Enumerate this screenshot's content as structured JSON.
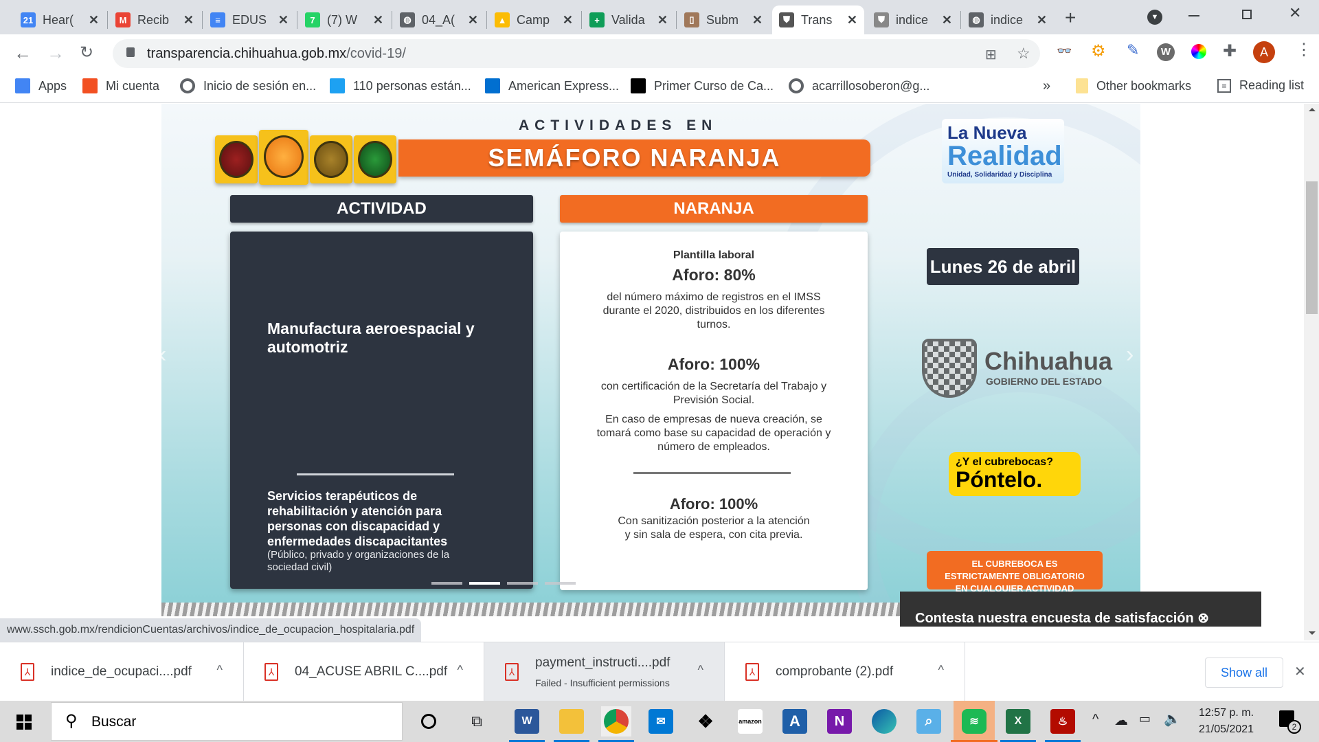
{
  "browser": {
    "tabs": [
      {
        "title": "Hear(",
        "icon": "google-calendar-icon",
        "color": "#4285f4",
        "glyph": "21"
      },
      {
        "title": "Recib",
        "icon": "gmail-icon",
        "color": "#ea4335",
        "glyph": "M"
      },
      {
        "title": "EDUS",
        "icon": "google-docs-icon",
        "color": "#4285f4",
        "glyph": "≡"
      },
      {
        "title": "(7) W",
        "icon": "whatsapp-icon",
        "color": "#25d366",
        "glyph": "7"
      },
      {
        "title": "04_A(",
        "icon": "globe-icon",
        "color": "#5f6368",
        "glyph": "◍"
      },
      {
        "title": "Camp",
        "icon": "google-drive-icon",
        "color": "#fbbc04",
        "glyph": "▲"
      },
      {
        "title": "Valida",
        "icon": "plus-cross-icon",
        "color": "#0f9d58",
        "glyph": "+"
      },
      {
        "title": "Subm",
        "icon": "door-icon",
        "color": "#a0785a",
        "glyph": "▯"
      },
      {
        "title": "Trans",
        "icon": "chihuahua-shield-icon",
        "color": "#555",
        "glyph": "⛊",
        "active": true
      },
      {
        "title": "indice",
        "icon": "chihuahua-shield-icon",
        "color": "#888",
        "glyph": "⛊"
      },
      {
        "title": "indice",
        "icon": "globe-icon",
        "color": "#5f6368",
        "glyph": "◍"
      }
    ],
    "new_tab": "+",
    "url_host": "transparencia.chihuahua.gob.mx",
    "url_path": "/covid-19/",
    "profile_initial": "A",
    "bookmarks": [
      {
        "label": "Apps",
        "icon": "apps-grid-icon"
      },
      {
        "label": "Mi cuenta",
        "icon": "microsoft-icon"
      },
      {
        "label": "Inicio de sesión en...",
        "icon": "globe-icon"
      },
      {
        "label": "110 personas están...",
        "icon": "twitter-icon"
      },
      {
        "label": "American Express...",
        "icon": "amex-icon"
      },
      {
        "label": "Primer Curso de Ca...",
        "icon": "x-icon"
      },
      {
        "label": "acarrillosoberon@g...",
        "icon": "globe-icon"
      }
    ],
    "bookmarks_overflow": "»",
    "other_bookmarks": "Other bookmarks",
    "reading_list": "Reading list"
  },
  "banner": {
    "heading_small": "ACTIVIDADES EN",
    "heading_big": "SEMÁFORO NARANJA",
    "col_activity_header": "ACTIVIDAD",
    "col_level_header": "NARANJA",
    "activity_1": "Manufactura aeroespacial y automotriz",
    "activity_2_title": "Servicios terapéuticos de rehabilitación y atención para personas con discapacidad y enfermedades discapacitantes",
    "activity_2_note": "(Público, privado y organizaciones de la sociedad civil)",
    "level_1_label": "Plantilla laboral",
    "level_1_aforo": "Aforo: 80%",
    "level_1_desc": "del número máximo de registros en el IMSS durante el 2020, distribuidos en los diferentes turnos.",
    "level_1b_aforo": "Aforo: 100%",
    "level_1b_desc": "con certificación de la Secretaría del Trabajo y Previsión Social.",
    "level_1b_note": "En caso de empresas de nueva creación, se tomará como base su capacidad de operación y número de empleados.",
    "level_2_aforo": "Aforo: 100%",
    "level_2_desc": "Con sanitización posterior a la atención y sin sala de espera, con cita previa.",
    "brand_line1": "La Nueva",
    "brand_line2": "Realidad",
    "brand_tagline": "Unidad, Solidaridad y Disciplina",
    "date": "Lunes 26 de abril",
    "gov_name": "Chihuahua",
    "gov_sub": "GOBIERNO DEL ESTADO",
    "mask_q": "¿Y el cubrebocas?",
    "mask_cta": "Póntelo.",
    "mask_notice": "EL CUBREBOCA ES ESTRICTAMENTE OBLIGATORIO EN CUALQUIER ACTIVIDAD",
    "slide_count": 4,
    "active_slide": 2,
    "colors": {
      "orange": "#f26c22",
      "navy": "#2d3440",
      "yellow": "#ffd60a"
    }
  },
  "survey": {
    "label": "Contesta nuestra encuesta de satisfacción ⊗"
  },
  "status_url": "www.ssch.gob.mx/rendicionCuentas/archivos/indice_de_ocupacion_hospitalaria.pdf",
  "downloads": {
    "items": [
      {
        "name": "indice_de_ocupaci....pdf",
        "sub": ""
      },
      {
        "name": "04_ACUSE ABRIL C....pdf",
        "sub": ""
      },
      {
        "name": "payment_instructi....pdf",
        "sub": "Failed - Insufficient permissions"
      },
      {
        "name": "comprobante (2).pdf",
        "sub": ""
      }
    ],
    "show_all": "Show all",
    "close": "✕"
  },
  "taskbar": {
    "search_placeholder": "Buscar",
    "time": "12:57 p. m.",
    "date": "21/05/2021",
    "notifications": "2"
  }
}
